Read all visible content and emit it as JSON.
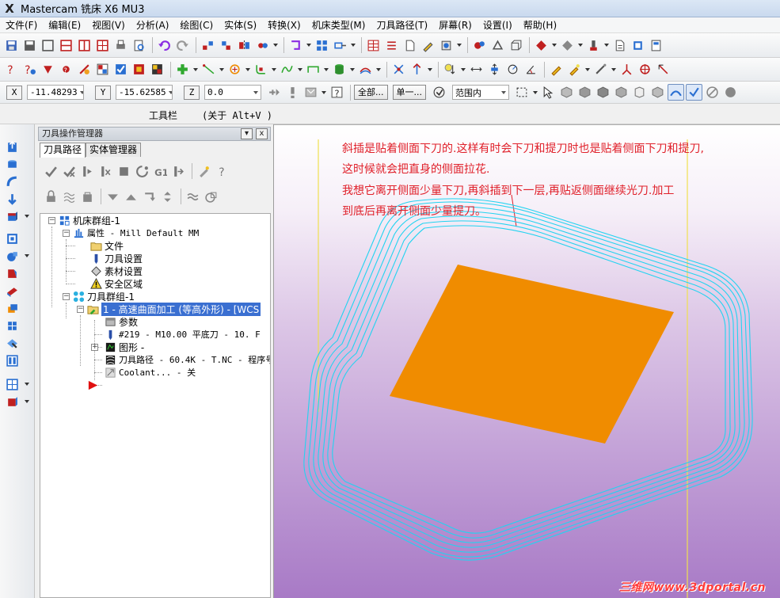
{
  "window": {
    "title": "Mastercam 铣床 X6 MU3",
    "app_icon": "X"
  },
  "menu": [
    "文件(F)",
    "编辑(E)",
    "视图(V)",
    "分析(A)",
    "绘图(C)",
    "实体(S)",
    "转换(X)",
    "机床类型(M)",
    "刀具路径(T)",
    "屏幕(R)",
    "设置(I)",
    "帮助(H)"
  ],
  "coords": {
    "x_label": "X",
    "x_value": "-11.48293",
    "y_label": "Y",
    "y_value": "-15.62585",
    "z_label": "Z",
    "z_value": "0.0",
    "all_button": "全部...",
    "single_button": "单一...",
    "range_select": "范围内"
  },
  "toolbar_caption": {
    "label": "工具栏",
    "hint": "(关于 Alt+V )"
  },
  "ops_manager": {
    "title": "刀具操作管理器",
    "pin": "▾",
    "close": "x",
    "tabs": [
      "刀具路径",
      "实体管理器"
    ],
    "tree": {
      "machine_group": "机床群组-1",
      "properties": "属性 - Mill Default MM",
      "files": "文件",
      "tool_settings": "刀具设置",
      "stock_settings": "素材设置",
      "safety_zone": "安全区域",
      "toolpath_group": "刀具群组-1",
      "operation": "1 - 高速曲面加工 (等高外形) - [WCS",
      "parameters": "参数",
      "tool": "#219 - M10.00 平底刀 -    10. F",
      "geometry": "图形 -",
      "toolpath": "刀具路径 - 60.4K - T.NC - 程序号",
      "coolant": "Coolant... - 关"
    }
  },
  "viewport": {
    "annotation_lines": [
      "斜插是贴着侧面下刀的.这样有时会下刀和提刀时也是贴着侧面下刀和提刀,",
      "这时候就会把直身的侧面拉花.",
      "我想它离开侧面少量下刀,再斜插到下一层,再贴返侧面继续光刀.加工",
      "到底后再离开侧面少量提刀。"
    ],
    "watermark": "三维网www.3dportal.cn",
    "colors": {
      "annotation": "#e0202a",
      "toolpath": "#22d3f0",
      "surface": "#f08c00",
      "bound_line": "#f0e050",
      "selection": "#3a6fd1"
    }
  }
}
